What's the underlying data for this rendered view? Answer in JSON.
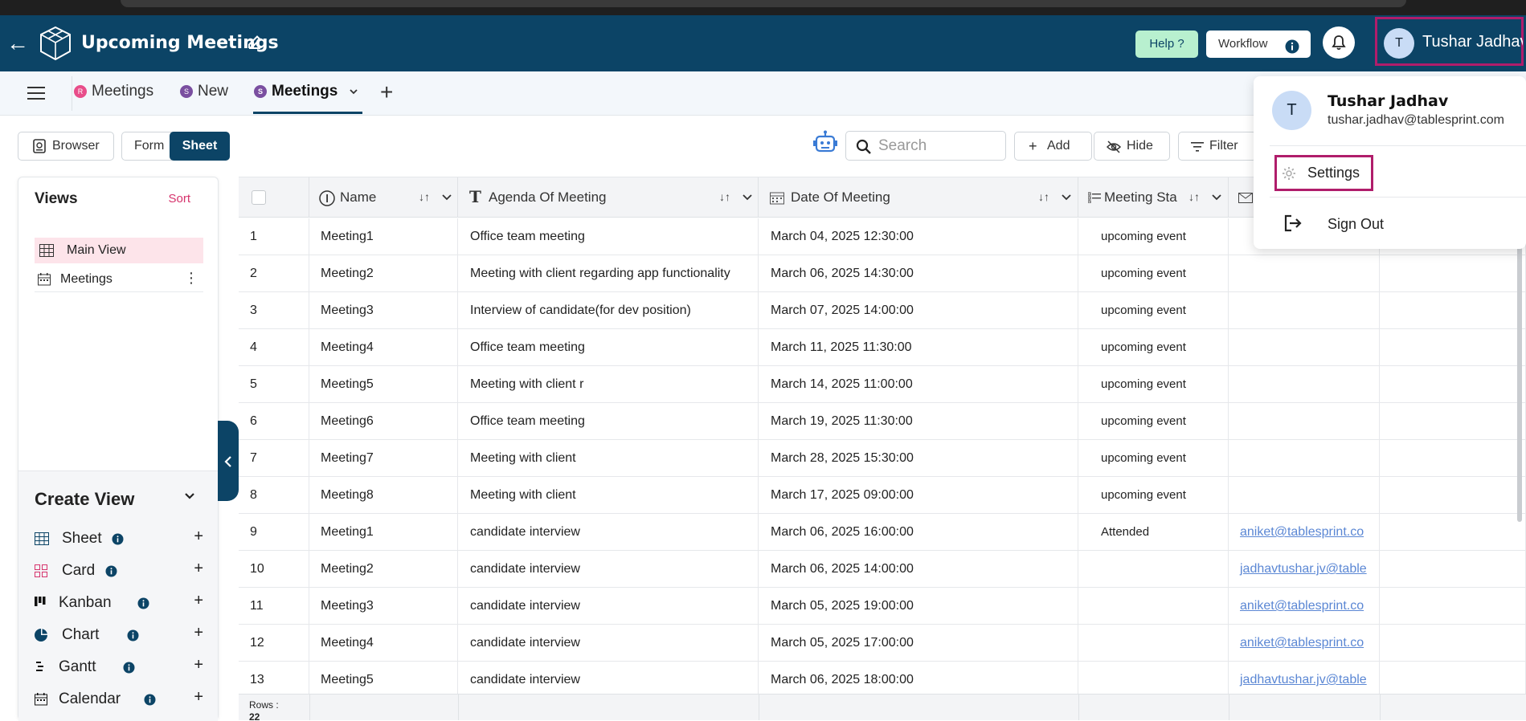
{
  "header": {
    "title": "Upcoming Meetings",
    "help_label": "Help ?",
    "workflow_label": "Workflow",
    "user_initial": "T",
    "user_name": "Tushar Jadhav"
  },
  "tabs": [
    {
      "badge": "R",
      "label": "Meetings",
      "badge_color": "#e84d8a"
    },
    {
      "badge": "S",
      "label": "New",
      "badge_color": "#7a4fa0"
    },
    {
      "badge": "S",
      "label": "Meetings",
      "badge_color": "#7a4fa0"
    }
  ],
  "toolbar": {
    "browser_label": "Browser",
    "form_label": "Form",
    "sheet_label": "Sheet",
    "search_placeholder": "Search",
    "add_label": "Add",
    "hide_label": "Hide",
    "filter_label": "Filter"
  },
  "views": {
    "title": "Views",
    "sort_label": "Sort",
    "items": [
      "Main View",
      "Meetings"
    ]
  },
  "create_view": {
    "title": "Create View",
    "items": [
      "Sheet",
      "Card",
      "Kanban",
      "Chart",
      "Gantt",
      "Calendar"
    ]
  },
  "table": {
    "columns": [
      "Name",
      "Agenda Of Meeting",
      "Date Of Meeting",
      "Meeting Sta"
    ],
    "rows": [
      {
        "n": "1",
        "name": "Meeting1",
        "agenda": "Office team meeting",
        "date": "March 04, 2025 12:30:00",
        "status": "upcoming event",
        "email": ""
      },
      {
        "n": "2",
        "name": "Meeting2",
        "agenda": "Meeting with client regarding app functionality",
        "date": "March 06, 2025 14:30:00",
        "status": "upcoming event",
        "email": ""
      },
      {
        "n": "3",
        "name": "Meeting3",
        "agenda": "Interview of candidate(for dev position)",
        "date": "March 07, 2025 14:00:00",
        "status": "upcoming event",
        "email": ""
      },
      {
        "n": "4",
        "name": "Meeting4",
        "agenda": "Office team meeting",
        "date": "March 11, 2025 11:30:00",
        "status": "upcoming event",
        "email": ""
      },
      {
        "n": "5",
        "name": "Meeting5",
        "agenda": "Meeting with client r",
        "date": "March 14, 2025 11:00:00",
        "status": "upcoming event",
        "email": ""
      },
      {
        "n": "6",
        "name": "Meeting6",
        "agenda": "Office team meeting",
        "date": "March 19, 2025 11:30:00",
        "status": "upcoming event",
        "email": ""
      },
      {
        "n": "7",
        "name": "Meeting7",
        "agenda": "Meeting with client",
        "date": "March 28, 2025 15:30:00",
        "status": "upcoming event",
        "email": ""
      },
      {
        "n": "8",
        "name": "Meeting8",
        "agenda": "Meeting with client",
        "date": "March 17, 2025 09:00:00",
        "status": "upcoming event",
        "email": ""
      },
      {
        "n": "9",
        "name": "Meeting1",
        "agenda": "candidate interview",
        "date": "March 06, 2025 16:00:00",
        "status": "Attended",
        "email": "aniket@tablesprint.co"
      },
      {
        "n": "10",
        "name": "Meeting2",
        "agenda": "candidate interview",
        "date": "March 06, 2025 14:00:00",
        "status": "",
        "email": "jadhavtushar.jv@table"
      },
      {
        "n": "11",
        "name": "Meeting3",
        "agenda": "candidate interview",
        "date": "March 05, 2025 19:00:00",
        "status": "",
        "email": "aniket@tablesprint.co"
      },
      {
        "n": "12",
        "name": "Meeting4",
        "agenda": "candidate interview",
        "date": "March 05, 2025 17:00:00",
        "status": "",
        "email": "aniket@tablesprint.co"
      },
      {
        "n": "13",
        "name": "Meeting5",
        "agenda": "candidate interview",
        "date": "March 06, 2025 18:00:00",
        "status": "",
        "email": "jadhavtushar.jv@table"
      }
    ],
    "footer_rows_label": "Rows :",
    "footer_rows_value": "22"
  },
  "user_menu": {
    "initial": "T",
    "name": "Tushar Jadhav",
    "email": "tushar.jadhav@tablesprint.com",
    "settings_label": "Settings",
    "signout_label": "Sign Out"
  },
  "colors": {
    "header_bg": "#0c4466",
    "highlight_border": "#b01d6b",
    "sort_link": "#d6336c"
  }
}
